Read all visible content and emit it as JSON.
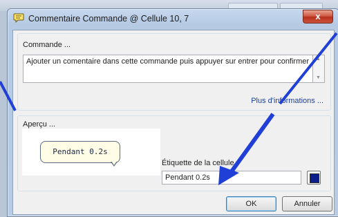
{
  "window": {
    "title": "Commentaire Commande @ Cellule 10, 7",
    "close_label": "x"
  },
  "command_section": {
    "label": "Commande ...",
    "comment_text": "Ajouter un comentaire dans cette commande puis appuyer sur entrer pour confirmer",
    "more_info_link": "Plus d'informations ..."
  },
  "preview_section": {
    "label": "Aperçu ...",
    "bubble_text": "Pendant 0.2s",
    "field_label": "Étiquette de la cellule",
    "field_value": "Pendant 0.2s",
    "color_swatch": "#0b1e8a"
  },
  "buttons": {
    "ok": "OK",
    "cancel": "Annuler"
  },
  "colors": {
    "annotation_arrow": "#1f3fd6",
    "link": "#1c3f9e"
  }
}
